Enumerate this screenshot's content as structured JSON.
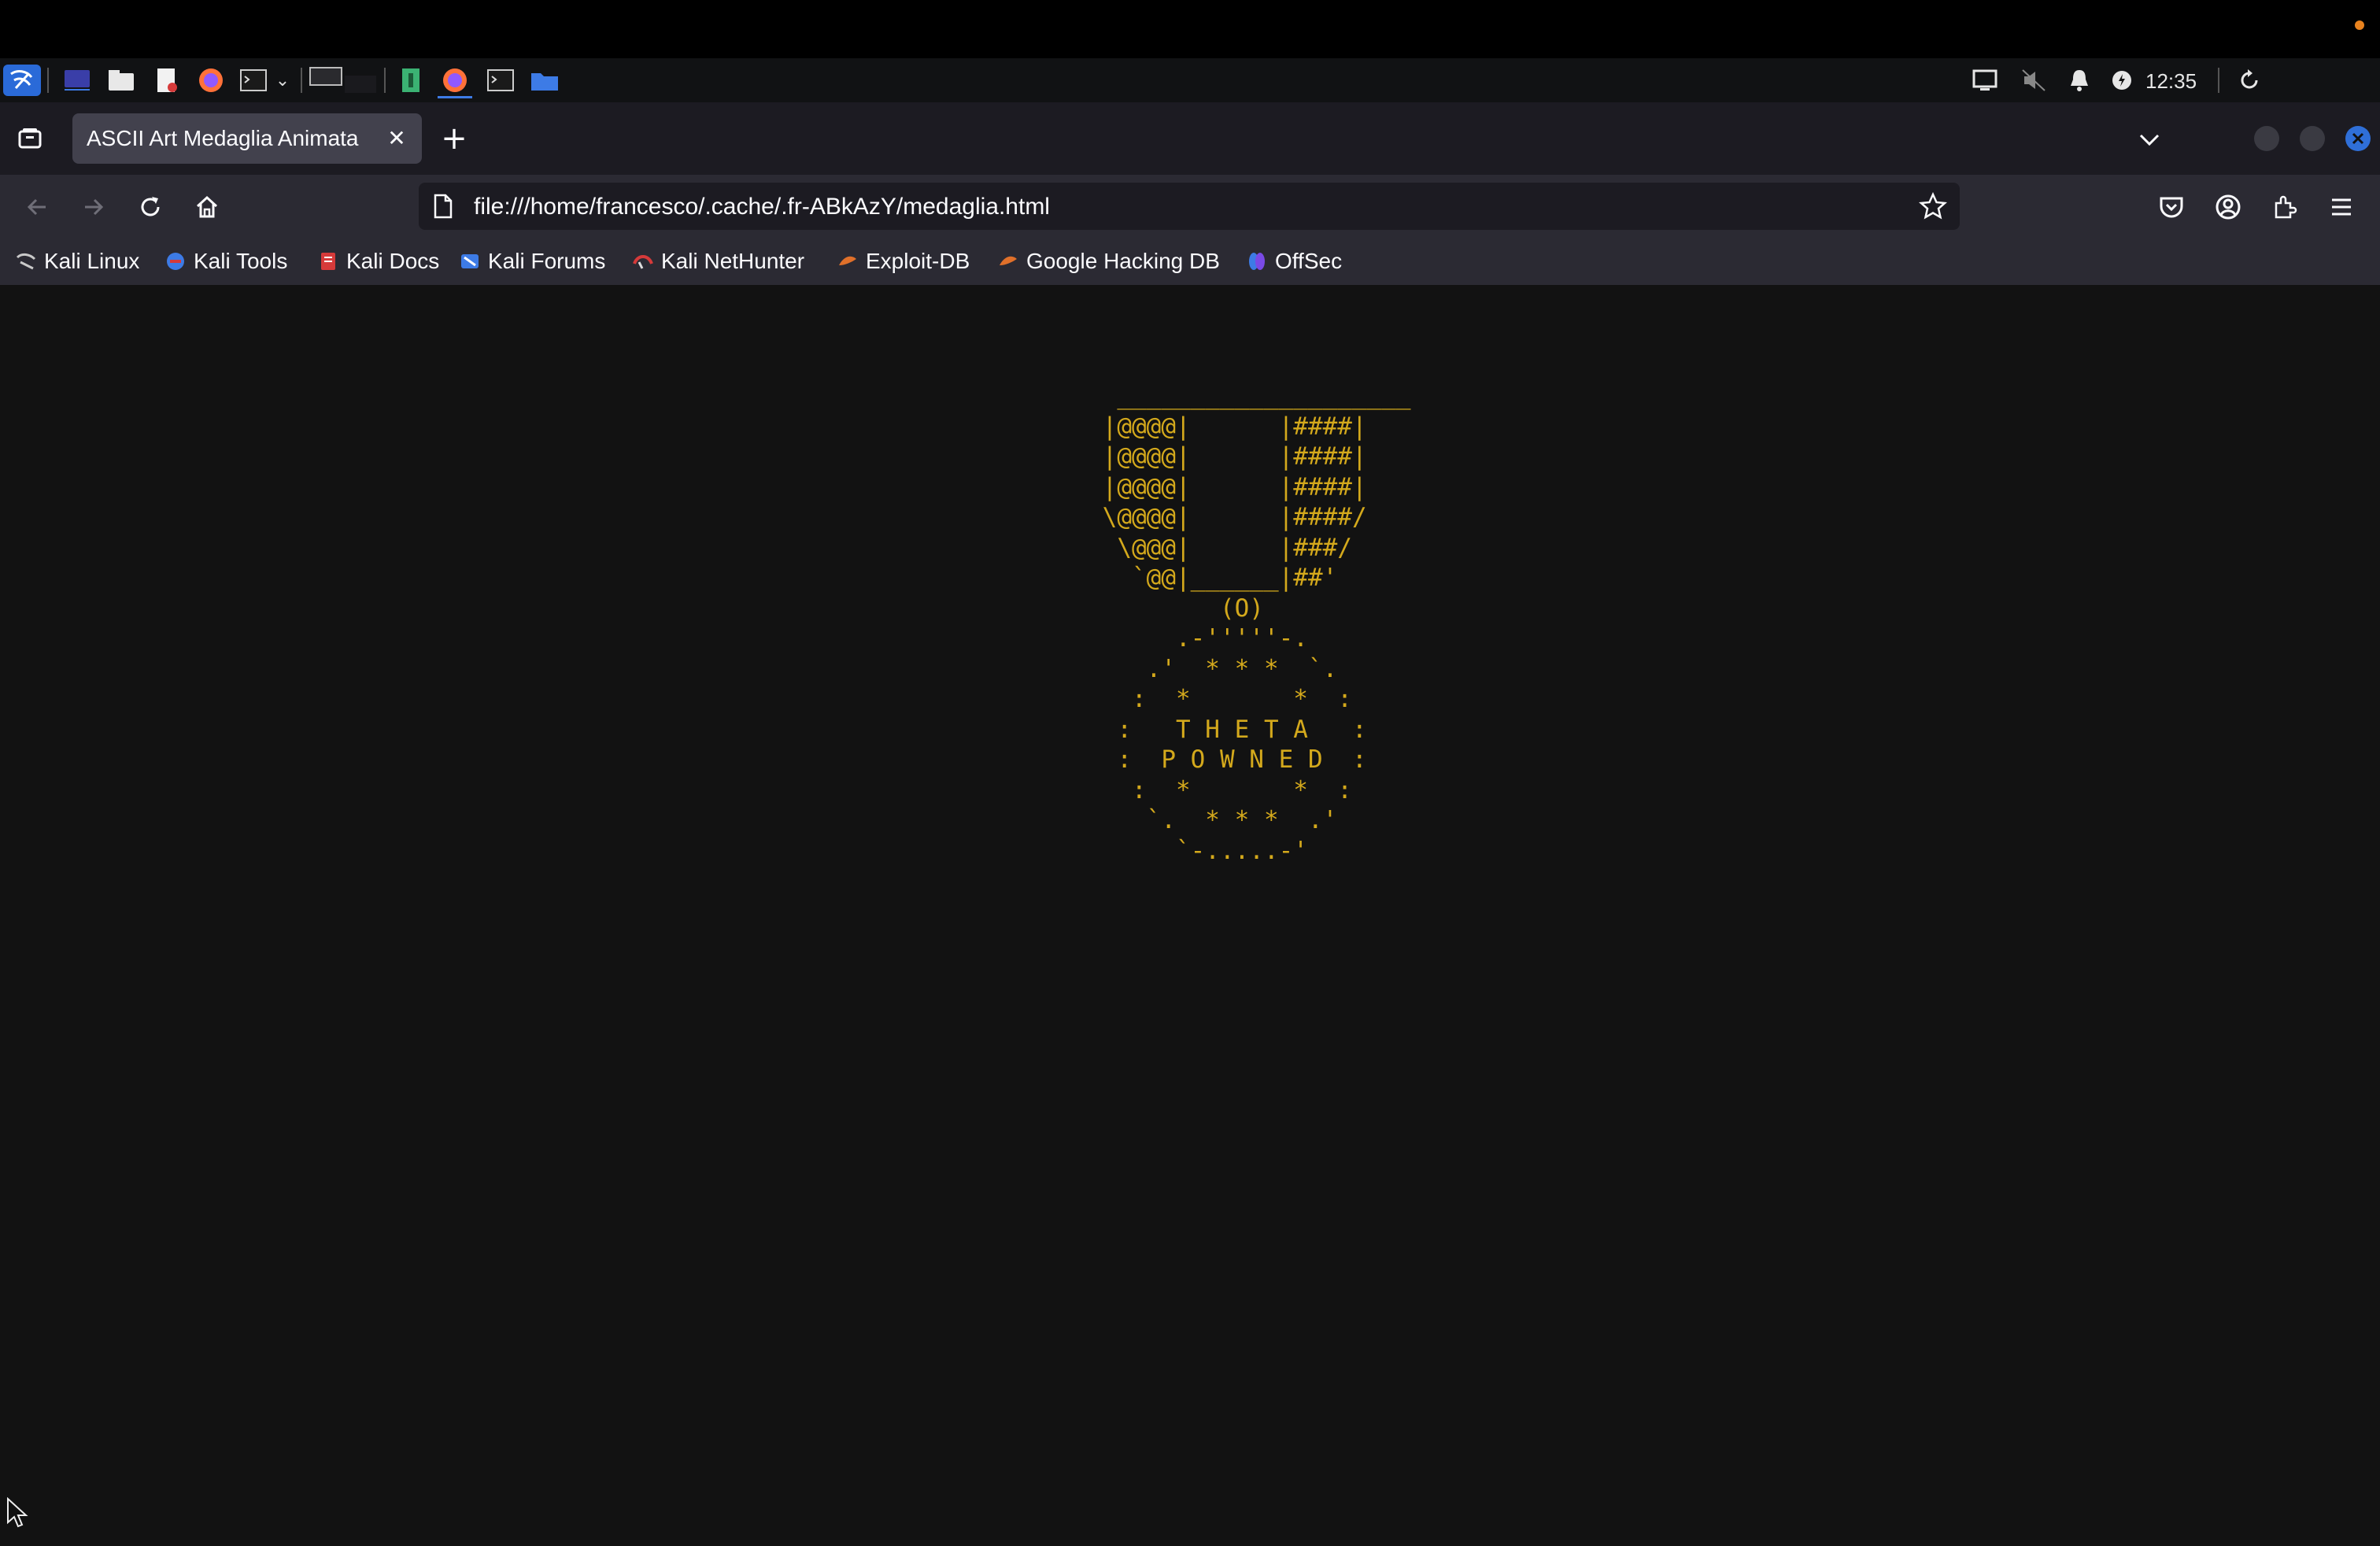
{
  "panel": {
    "clock": "12:35",
    "app_icons": [
      "kali-menu-icon",
      "desktop-icon",
      "file-manager-icon",
      "text-editor-icon",
      "firefox-icon",
      "terminal-icon",
      "workspace-switcher-icon"
    ],
    "tasks": [
      "text-editor-task-icon",
      "firefox-task-icon",
      "terminal-task-icon",
      "folder-task-icon"
    ]
  },
  "browser": {
    "tab_title": "ASCII Art Medaglia Animata",
    "url": "file:///home/francesco/.cache/.fr-ABkAzY/medaglia.html",
    "bookmarks": [
      {
        "label": "Kali Linux",
        "color": "#9aa0a6"
      },
      {
        "label": "Kali Tools",
        "color": "#3d7be6"
      },
      {
        "label": "Kali Docs",
        "color": "#d63a3a"
      },
      {
        "label": "Kali Forums",
        "color": "#3d7be6"
      },
      {
        "label": "Kali NetHunter",
        "color": "#d63a3a"
      },
      {
        "label": "Exploit-DB",
        "color": "#e0702a"
      },
      {
        "label": "Google Hacking DB",
        "color": "#e0702a"
      },
      {
        "label": "OffSec",
        "color": "#4a5ae6"
      }
    ]
  },
  "page": {
    "ascii_art": "  ____________________\n |@@@@|      |####|\n |@@@@|      |####|\n |@@@@|      |####|\n \\@@@@|      |####/\n  \\@@@|      |###/\n   `@@|______|##'\n         (O)\n      .-'''''-.\n    .'  * * *  `.\n   :  *       *  :\n  :   T H E T A   :\n  :  P O W N E D  :\n   :  *       *  :\n    `.  * * *  .'\n      `-.....-'",
    "text_color": "#d4a91c"
  }
}
